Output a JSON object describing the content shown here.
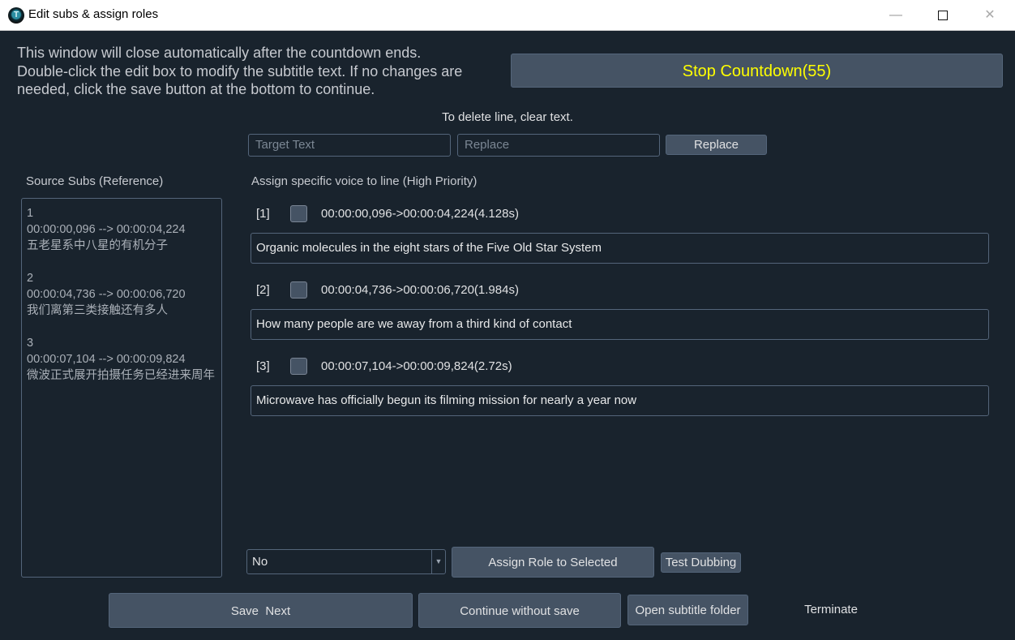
{
  "window": {
    "title": "Edit subs & assign roles",
    "icon": "T",
    "minimize_glyph": "—",
    "close_glyph": "✕"
  },
  "header": {
    "info_lines": [
      "This window will close automatically after the countdown ends.",
      "Double-click the edit box to modify the subtitle text. If no changes are",
      "needed, click the save button at the bottom to continue."
    ],
    "stop_label": "Stop Countdown(55)",
    "delete_hint": "To delete line, clear text."
  },
  "search": {
    "target_placeholder": "Target Text",
    "replace_placeholder": "Replace",
    "replace_button": "Replace"
  },
  "source": {
    "label": "Source Subs (Reference)",
    "blocks": [
      {
        "index": "1",
        "time": "00:00:00,096 --> 00:00:04,224",
        "text": "五老星系中八星的有机分子"
      },
      {
        "index": "2",
        "time": "00:00:04,736 --> 00:00:06,720",
        "text": "我们离第三类接触还有多人"
      },
      {
        "index": "3",
        "time": "00:00:07,104 --> 00:00:09,824",
        "text": "微波正式展开拍摄任务已经进来周年"
      }
    ]
  },
  "assign": {
    "label": "Assign specific voice to line (High Priority)",
    "lines": [
      {
        "index": "[1]",
        "time": "00:00:00,096->00:00:04,224(4.128s)",
        "text": "Organic molecules in the eight stars of the Five Old Star System",
        "checked": false
      },
      {
        "index": "[2]",
        "time": "00:00:04,736->00:00:06,720(1.984s)",
        "text": "How many people are we away from a third kind of contact",
        "checked": false
      },
      {
        "index": "[3]",
        "time": "00:00:07,104->00:00:09,824(2.72s)",
        "text": "Microwave has officially begun its filming mission for nearly a year now",
        "checked": false
      }
    ]
  },
  "bottom": {
    "role_value": "No",
    "assign_button": "Assign Role to Selected",
    "test_button": "Test Dubbing",
    "save_button": "Save  Next",
    "continue_button": "Continue without save",
    "folder_button": "Open subtitle folder",
    "terminate_button": "Terminate"
  }
}
